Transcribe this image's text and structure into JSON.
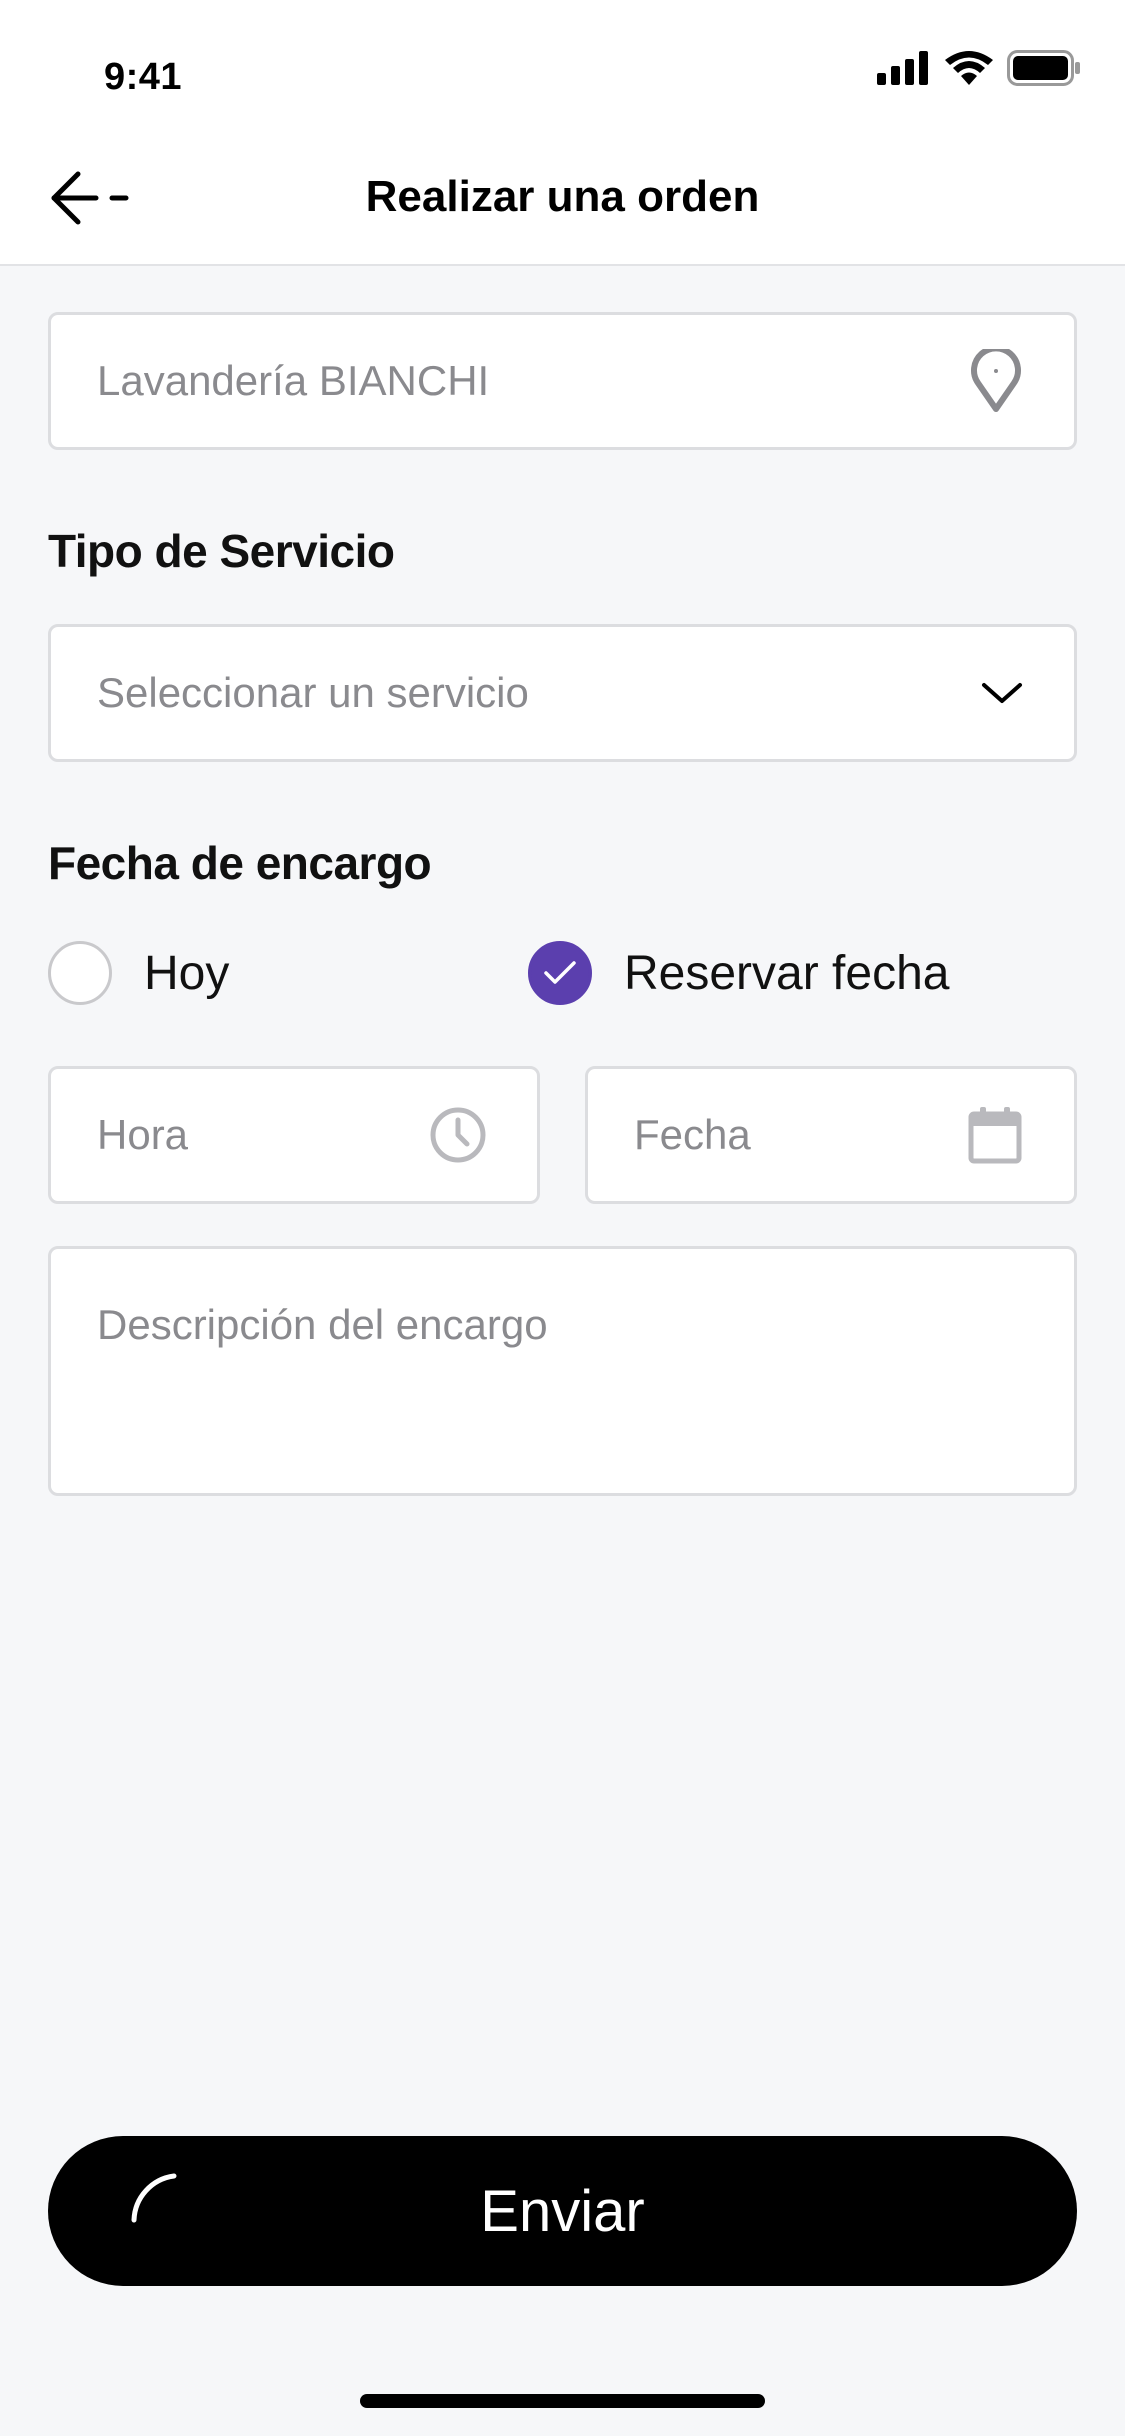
{
  "status_bar": {
    "time": "9:41",
    "icons": [
      "signal-icon",
      "wifi-icon",
      "battery-icon"
    ]
  },
  "nav": {
    "title": "Realizar una orden",
    "back_icon": "arrow-left-icon"
  },
  "location_field": {
    "placeholder": "Lavandería BIANCHI",
    "icon": "map-pin-icon"
  },
  "service_section": {
    "label": "Tipo de Servicio",
    "select_placeholder": "Seleccionar un servicio",
    "icon": "chevron-down-icon"
  },
  "date_section": {
    "label": "Fecha de encargo",
    "options": [
      {
        "label": "Hoy",
        "checked": false
      },
      {
        "label": "Reservar fecha",
        "checked": true
      }
    ],
    "time_placeholder": "Hora",
    "time_icon": "clock-icon",
    "date_placeholder": "Fecha",
    "date_icon": "calendar-icon"
  },
  "description": {
    "placeholder": "Descripción del encargo"
  },
  "submit": {
    "label": "Enviar",
    "icon": "spinner-icon"
  },
  "colors": {
    "accent": "#5b3fae",
    "background": "#f6f7f9",
    "button": "#000000",
    "placeholder": "#8a8a8e",
    "border": "#dcdde0"
  }
}
